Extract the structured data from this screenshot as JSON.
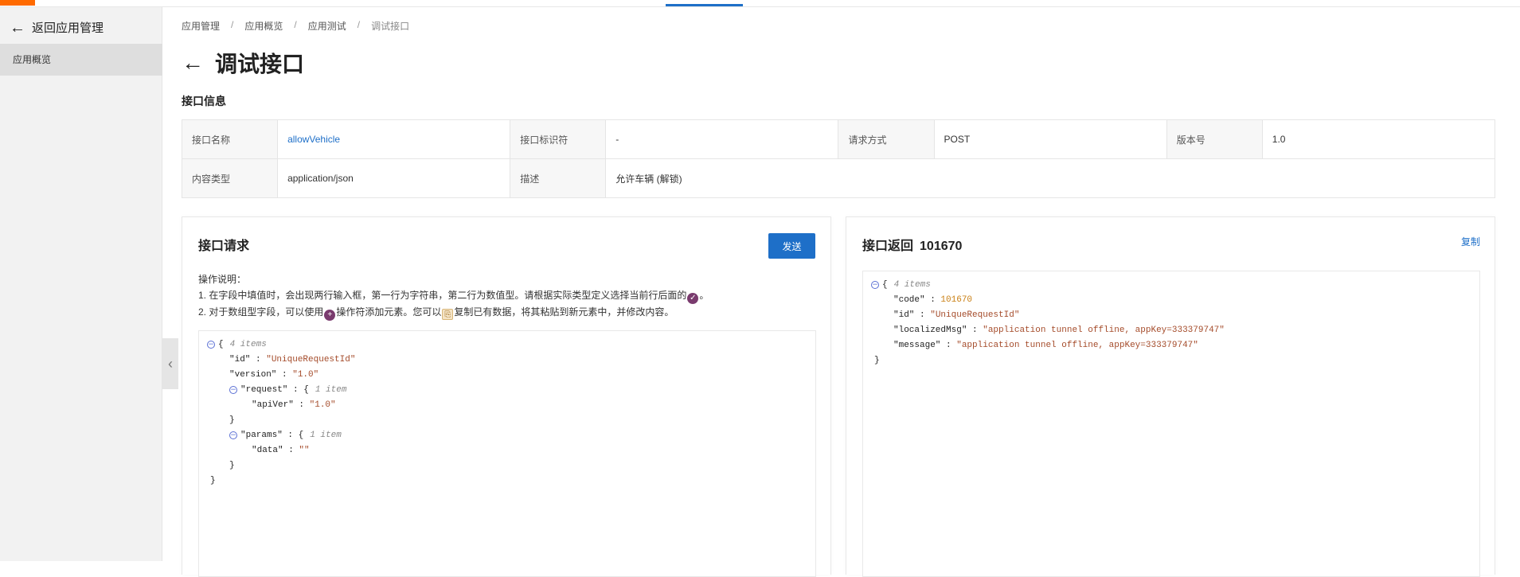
{
  "sidebar": {
    "back_label": "返回应用管理",
    "items": [
      {
        "label": "应用概览"
      }
    ]
  },
  "breadcrumb": [
    "应用管理",
    "应用概览",
    "应用测试",
    "调试接口"
  ],
  "page_title": "调试接口",
  "section_title": "接口信息",
  "info": {
    "name_label": "接口名称",
    "name_value": "allowVehicle",
    "id_label": "接口标识符",
    "id_value": "-",
    "method_label": "请求方式",
    "method_value": "POST",
    "version_label": "版本号",
    "version_value": "1.0",
    "content_type_label": "内容类型",
    "content_type_value": "application/json",
    "desc_label": "描述",
    "desc_value": "允许车辆 (解锁)"
  },
  "request": {
    "title": "接口请求",
    "send_label": "发送",
    "instructions": {
      "heading": "操作说明：",
      "line1_a": "1. 在字段中填值时，会出现两行输入框，第一行为字符串，第二行为数值型。请根据实际类型定义选择当前行后面的",
      "line1_b": "。",
      "line2_a": "2. 对于数组型字段，可以使用",
      "line2_b": "操作符添加元素。您可以",
      "line2_c": "复制已有数据，将其粘贴到新元素中，并修改内容。"
    },
    "json": {
      "root_count": "4 items",
      "id_key": "\"id\"",
      "id_val": "\"UniqueRequestId\"",
      "version_key": "\"version\"",
      "version_val": "\"1.0\"",
      "request_key": "\"request\"",
      "request_count": "1 item",
      "apiver_key": "\"apiVer\"",
      "apiver_val": "\"1.0\"",
      "params_key": "\"params\"",
      "params_count": "1 item",
      "data_key": "\"data\"",
      "data_val": "\"\""
    }
  },
  "response": {
    "title": "接口返回",
    "code": "101670",
    "copy_label": "复制",
    "json": {
      "root_count": "4 items",
      "code_key": "\"code\"",
      "code_val": "101670",
      "id_key": "\"id\"",
      "id_val": "\"UniqueRequestId\"",
      "lmsg_key": "\"localizedMsg\"",
      "lmsg_val": "\"application tunnel offline, appKey=333379747\"",
      "msg_key": "\"message\"",
      "msg_val": "\"application tunnel offline, appKey=333379747\""
    }
  },
  "colors": {
    "accent": "#1e6fc8",
    "brand": "#ff6a00"
  },
  "icons": {
    "back": "arrow-left-icon",
    "collapse": "chevron-left-icon",
    "check": "check-circle-icon",
    "add": "plus-circle-icon",
    "copy": "clipboard-icon"
  }
}
